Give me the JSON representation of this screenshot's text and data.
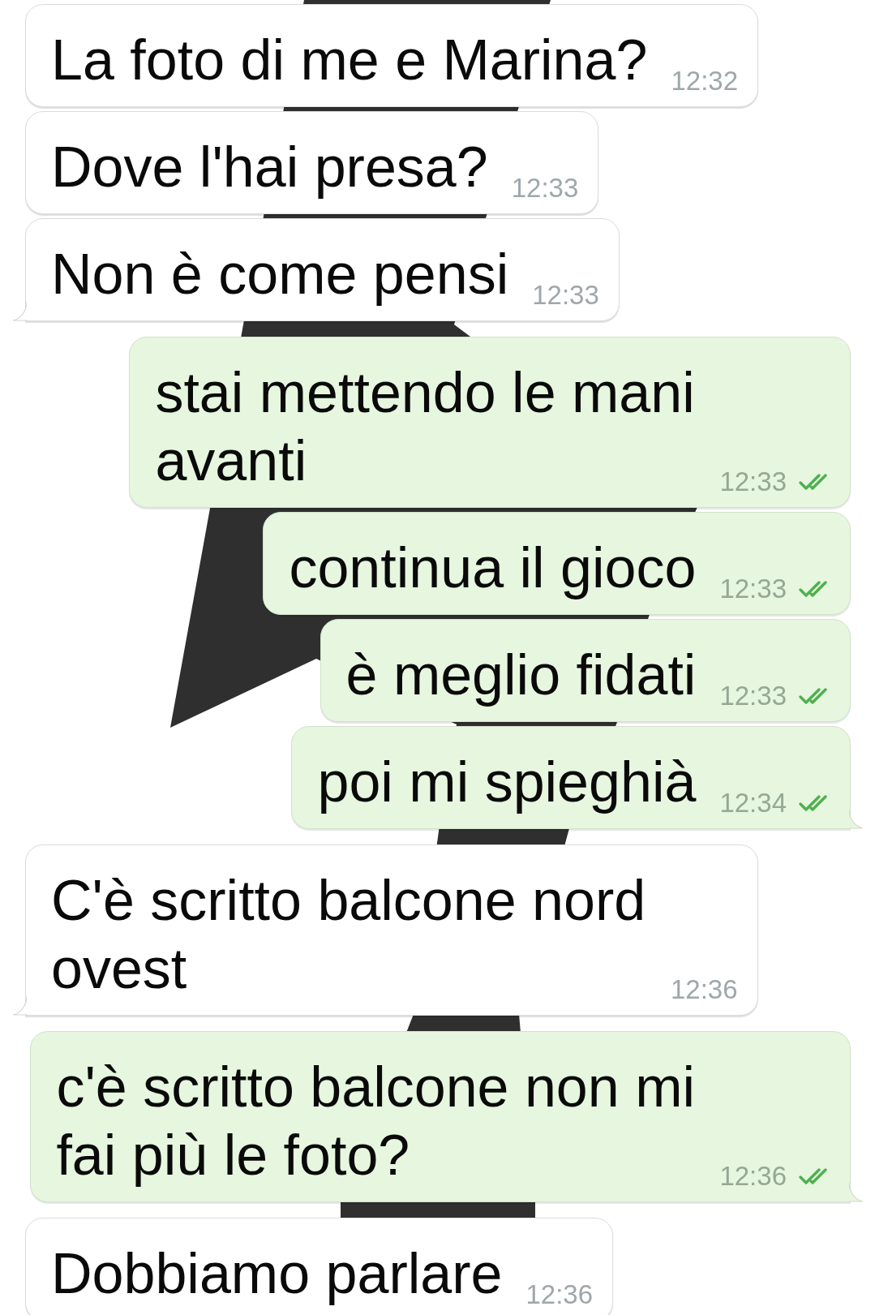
{
  "messages": [
    {
      "kind": "incoming",
      "text": "La foto di me e Marina?",
      "time": "12:32",
      "tail": false
    },
    {
      "kind": "incoming",
      "text": "Dove l'hai presa?",
      "time": "12:33",
      "tail": false
    },
    {
      "kind": "incoming",
      "text": "Non è come pensi",
      "time": "12:33",
      "tail": true
    },
    {
      "kind": "outgoing",
      "text": "stai mettendo le mani avanti",
      "time": "12:33",
      "tail": false,
      "read": true
    },
    {
      "kind": "outgoing",
      "text": "continua il gioco",
      "time": "12:33",
      "tail": false,
      "read": true
    },
    {
      "kind": "outgoing",
      "text": "è meglio fidati",
      "time": "12:33",
      "tail": false,
      "read": true
    },
    {
      "kind": "outgoing",
      "text": "poi mi spieghià",
      "time": "12:34",
      "tail": true,
      "read": true
    },
    {
      "kind": "incoming",
      "text": "C'è scritto balcone nord ovest",
      "time": "12:36",
      "tail": true
    },
    {
      "kind": "outgoing",
      "text": "c'è scritto balcone non mi fai più le foto?",
      "time": "12:36",
      "tail": true,
      "read": true
    },
    {
      "kind": "incoming",
      "text": "Dobbiamo parlare",
      "time": "12:36",
      "tail": false
    }
  ]
}
